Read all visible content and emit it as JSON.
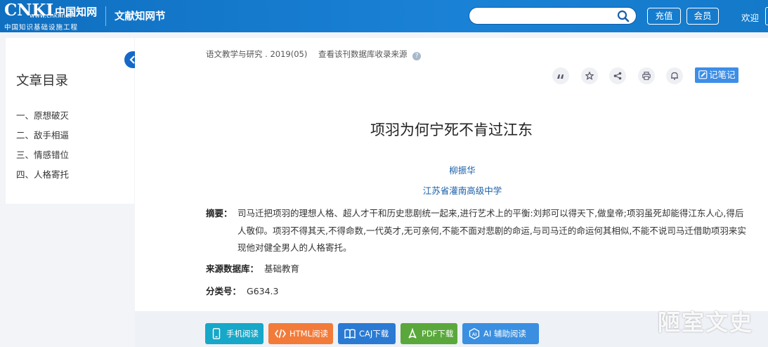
{
  "header": {
    "logo_main": "CNKI",
    "logo_cn": "中国知网",
    "logo_url": "www.cnki.net",
    "logo_sub": "中国知识基础设施工程",
    "section_title": "文献知网节",
    "search_placeholder": "",
    "recharge_label": "充值",
    "member_label": "会员",
    "welcome": "欢迎"
  },
  "sidebar": {
    "title": "文章目录",
    "items": [
      {
        "label": "一、原想破灭"
      },
      {
        "label": "二、敌手相逼"
      },
      {
        "label": "三、情感错位"
      },
      {
        "label": "四、人格寄托"
      }
    ]
  },
  "article": {
    "journal": "语文教学与研究",
    "issue": ". 2019(05)",
    "source_link": "查看该刊数据库收录来源",
    "help_icon_glyph": "?",
    "title": "项羽为何宁死不肯过江东",
    "author": "柳振华",
    "affiliation": "江苏省灌南高级中学",
    "abstract_label": "摘要：",
    "abstract_text": "司马迁把项羽的理想人格、超人才干和历史悲剧统一起来,进行艺术上的平衡:刘邦可以得天下,做皇帝;项羽虽死却能得江东人心,得后人敬仰。项羽不得其天,不得命数,一代英才,无可亲何,不能不面对悲剧的命运,与司马迁的命运何其相似,不能不说司马迁借助项羽来实现他对健全男人的人格寄托。",
    "db_label": "来源数据库：",
    "db_value": "基础教育",
    "cls_label": "分类号：",
    "cls_value": "G634.3"
  },
  "tools": {
    "notes_label": "记笔记",
    "icons": [
      "quote-icon",
      "star-icon",
      "share-icon",
      "print-icon",
      "bell-icon"
    ]
  },
  "downloads": {
    "mobile": "手机阅读",
    "html": "HTML阅读",
    "caj": "CAJ下载",
    "pdf": "PDF下载",
    "ai": "AI 辅助阅读"
  },
  "watermark": "陋室文史",
  "colors": {
    "header": "#1478c8",
    "link": "#1a5fa8",
    "mobile": "#17a7c8",
    "html": "#f27b3a",
    "caj": "#2a7ad3",
    "pdf": "#5aa83c",
    "ai": "#3a8fe0"
  }
}
